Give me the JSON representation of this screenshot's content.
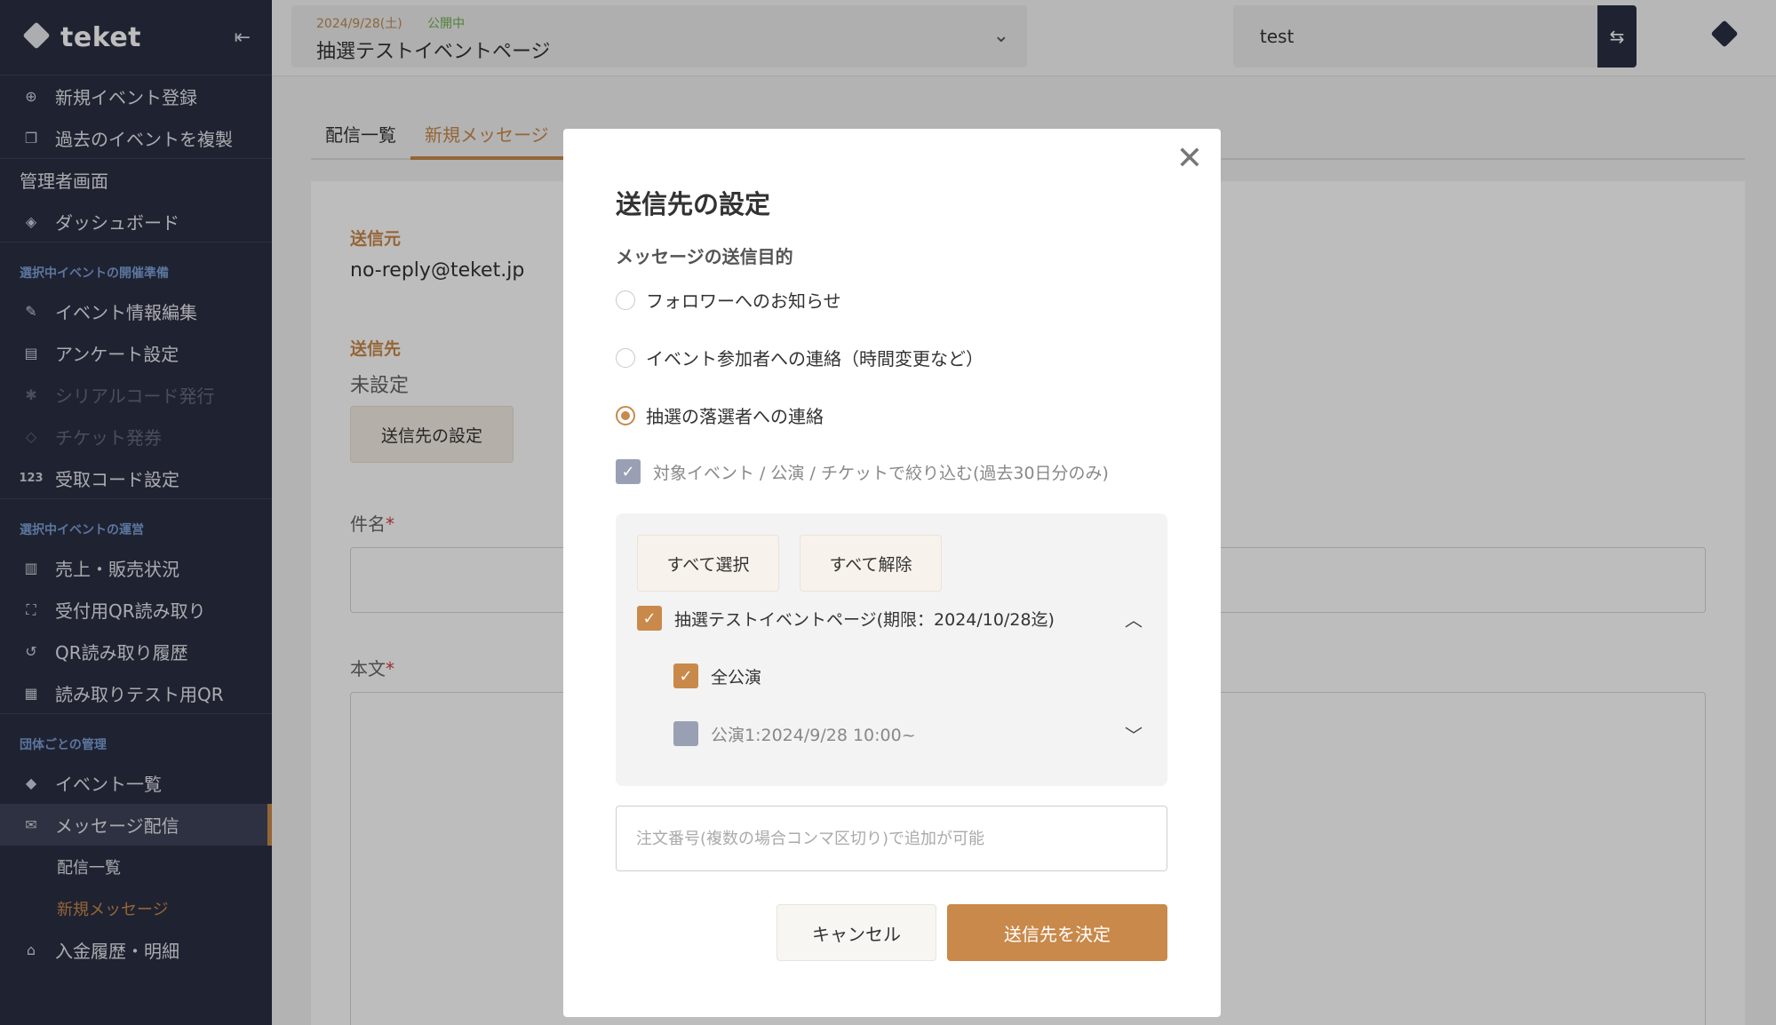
{
  "colors": {
    "accent": "#c9894a",
    "sidebar_bg": "#2b2f43",
    "section_label": "#7b9fd6",
    "status_green": "#6fae4d"
  },
  "brand": {
    "name": "teket",
    "collapse_icon": "collapse-icon"
  },
  "sidebar": {
    "items_top": [
      {
        "label": "新規イベント登録",
        "icon": "plus-circle-icon"
      },
      {
        "label": "過去のイベントを複製",
        "icon": "copy-icon"
      }
    ],
    "admin_label": "管理者画面",
    "dashboard": {
      "label": "ダッシュボード",
      "icon": "layers-icon"
    },
    "section_prepare": "選択中イベントの開催準備",
    "prepare_items": [
      {
        "label": "イベント情報編集",
        "icon": "edit-icon",
        "disabled": false
      },
      {
        "label": "アンケート設定",
        "icon": "document-icon",
        "disabled": false
      },
      {
        "label": "シリアルコード発行",
        "icon": "asterisk-icon",
        "disabled": true
      },
      {
        "label": "チケット発券",
        "icon": "tag-icon",
        "disabled": true
      },
      {
        "label": "受取コード設定",
        "icon": "code-123-icon",
        "icon_text": "123",
        "disabled": false
      }
    ],
    "section_operate": "選択中イベントの運営",
    "operate_items": [
      {
        "label": "売上・販売状況",
        "icon": "bar-chart-icon"
      },
      {
        "label": "受付用QR読み取り",
        "icon": "scan-icon"
      },
      {
        "label": "QR読み取り履歴",
        "icon": "history-icon"
      },
      {
        "label": "読み取りテスト用QR",
        "icon": "qr-icon"
      }
    ],
    "section_org": "団体ごとの管理",
    "org_items": [
      {
        "label": "イベント一覧",
        "icon": "ticket-icon"
      },
      {
        "label": "メッセージ配信",
        "icon": "mail-icon",
        "active": true
      }
    ],
    "sub_items": [
      {
        "label": "配信一覧",
        "current": false
      },
      {
        "label": "新規メッセージ",
        "current": true
      }
    ],
    "bottom_item": {
      "label": "入金履歴・明細",
      "icon": "bank-icon"
    }
  },
  "header": {
    "event_date": "2024/9/28(土)",
    "event_status": "公開中",
    "event_title": "抽選テストイベントページ",
    "org_name": "test"
  },
  "main": {
    "tabs": [
      {
        "label": "配信一覧",
        "active": false
      },
      {
        "label": "新規メッセージ",
        "active": true
      }
    ],
    "sender_label": "送信元",
    "sender_value": "no-reply@teket.jp",
    "recipient_label": "送信先",
    "recipient_value": "未設定",
    "recipient_button": "送信先の設定",
    "subject_label": "件名",
    "body_label": "本文",
    "required_mark": "*"
  },
  "modal": {
    "title": "送信先の設定",
    "purpose_label": "メッセージの送信目的",
    "options": [
      {
        "label": "フォロワーへのお知らせ",
        "selected": false
      },
      {
        "label": "イベント参加者への連絡（時間変更など）",
        "selected": false
      },
      {
        "label": "抽選の落選者への連絡",
        "selected": true
      }
    ],
    "filter_label": "対象イベント / 公演 / チケットで絞り込む(過去30日分のみ)",
    "select_all": "すべて選択",
    "deselect_all": "すべて解除",
    "event_entry": "抽選テストイベントページ(期限：2024/10/28迄)",
    "all_performances": "全公演",
    "performance_1": "公演1:2024/9/28 10:00~",
    "order_placeholder": "注文番号(複数の場合コンマ区切り)で追加が可能",
    "cancel": "キャンセル",
    "confirm": "送信先を決定"
  }
}
